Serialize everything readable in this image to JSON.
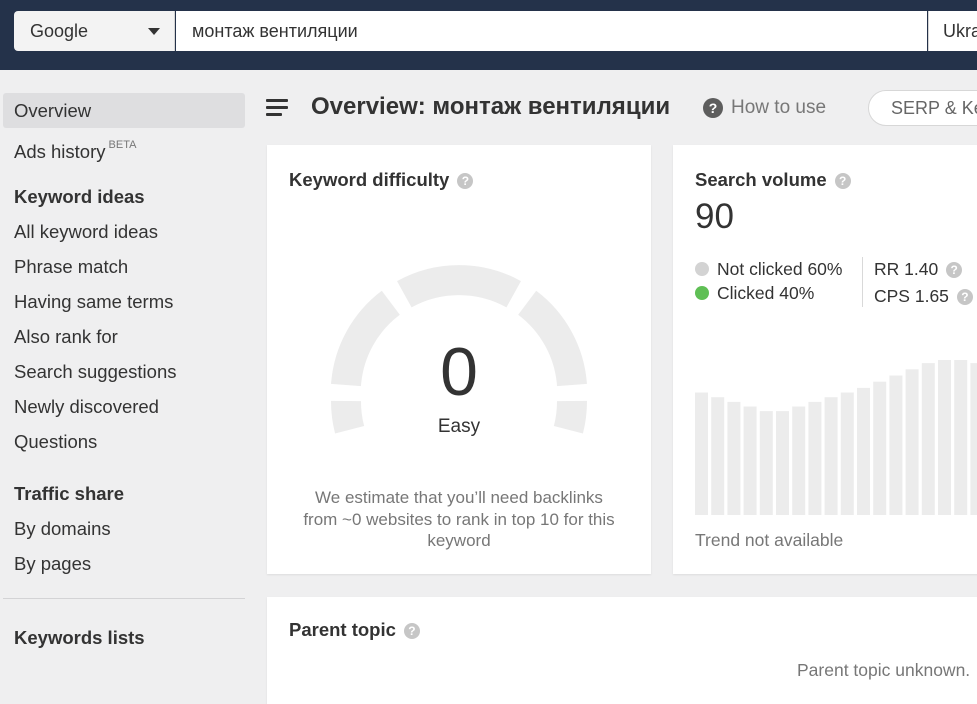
{
  "search": {
    "engine": "Google",
    "query": "монтаж вентиляции",
    "country": "Ukraine"
  },
  "sidebar": {
    "overview": "Overview",
    "ads_history": "Ads history",
    "ads_history_badge": "BETA",
    "keyword_ideas_heading": "Keyword ideas",
    "keyword_ideas": [
      "All keyword ideas",
      "Phrase match",
      "Having same terms",
      "Also rank for",
      "Search suggestions",
      "Newly discovered",
      "Questions"
    ],
    "traffic_share_heading": "Traffic share",
    "traffic_share": [
      "By domains",
      "By pages"
    ],
    "keywords_lists_heading": "Keywords lists"
  },
  "header": {
    "title": "Overview: монтаж вентиляции",
    "how_to_use": "How to use",
    "serp_button": "SERP & Keywords"
  },
  "keyword_difficulty": {
    "title": "Keyword difficulty",
    "value": "0",
    "label": "Easy",
    "note": "We estimate that you’ll need backlinks from ~0 websites to rank in top 10 for this keyword",
    "gauge_fill_fraction": 0
  },
  "search_volume": {
    "title": "Search volume",
    "value": "90",
    "not_clicked": "Not clicked 60%",
    "clicked": "Clicked 40%",
    "rr": "RR 1.40",
    "cps": "CPS 1.65",
    "trend_note": "Trend not available",
    "trend_relative_heights": [
      0.79,
      0.76,
      0.73,
      0.7,
      0.67,
      0.67,
      0.7,
      0.73,
      0.76,
      0.79,
      0.82,
      0.86,
      0.9,
      0.94,
      0.98,
      1.0,
      1.0,
      0.98,
      0.94
    ],
    "colors": {
      "not_clicked": "#d3d3d3",
      "clicked": "#5fbf55",
      "bars": "#ececec"
    }
  },
  "parent_topic": {
    "title": "Parent topic",
    "note": "Parent topic unknown."
  },
  "icons": {
    "help": "question-circle-icon",
    "menu": "hamburger-icon",
    "dropdown": "caret-down-icon"
  }
}
